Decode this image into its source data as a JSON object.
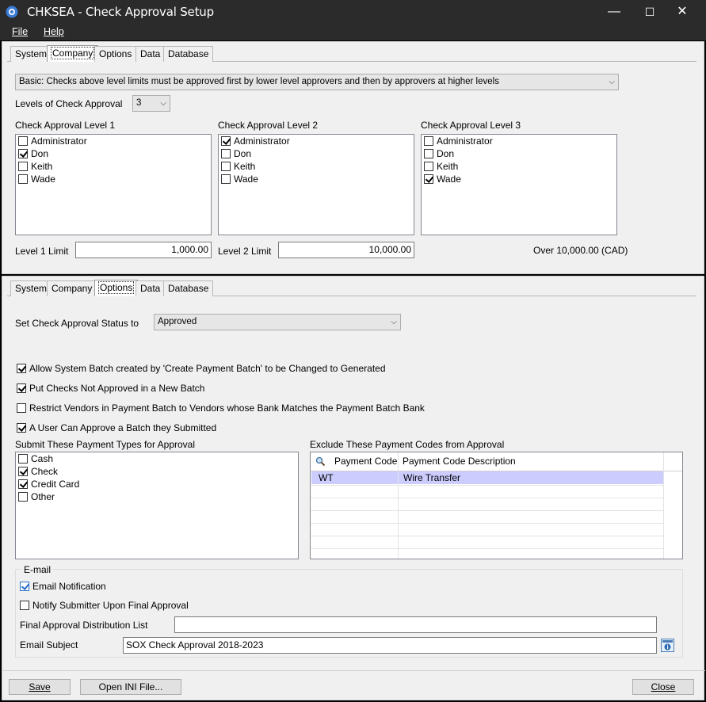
{
  "window": {
    "title": "CHKSEA - Check Approval Setup",
    "minimize": "—",
    "maximize": "☐",
    "close": "✕"
  },
  "menu": {
    "file": "File",
    "help": "Help"
  },
  "tabs": [
    "System",
    "Company",
    "Options",
    "Data",
    "Database"
  ],
  "company": {
    "approval_mode": "Basic: Checks above level limits must be approved first by lower level approvers and then by approvers at higher levels",
    "levels_label": "Levels of Check Approval",
    "levels_value": "3",
    "level1": {
      "label": "Check Approval Level 1",
      "items": [
        {
          "name": "Administrator",
          "checked": false
        },
        {
          "name": "Don",
          "checked": true
        },
        {
          "name": "Keith",
          "checked": false
        },
        {
          "name": "Wade",
          "checked": false
        }
      ]
    },
    "level2": {
      "label": "Check Approval Level 2",
      "items": [
        {
          "name": "Administrator",
          "checked": true
        },
        {
          "name": "Don",
          "checked": false
        },
        {
          "name": "Keith",
          "checked": false
        },
        {
          "name": "Wade",
          "checked": false
        }
      ]
    },
    "level3": {
      "label": "Check Approval Level 3",
      "items": [
        {
          "name": "Administrator",
          "checked": false
        },
        {
          "name": "Don",
          "checked": false
        },
        {
          "name": "Keith",
          "checked": false
        },
        {
          "name": "Wade",
          "checked": true
        }
      ]
    },
    "limit1_label": "Level 1 Limit",
    "limit1_value": "1,000.00",
    "limit2_label": "Level 2 Limit",
    "limit2_value": "10,000.00",
    "over_text": "Over 10,000.00 (CAD)"
  },
  "options": {
    "status_label": "Set Check Approval Status to",
    "status_value": "Approved",
    "opt1": {
      "label": "Allow System Batch created by 'Create Payment Batch' to be Changed to Generated",
      "checked": true
    },
    "opt2": {
      "label": "Put Checks Not Approved in a New Batch",
      "checked": true
    },
    "opt3": {
      "label": "Restrict Vendors in Payment Batch to Vendors whose Bank Matches the Payment Batch Bank",
      "checked": false
    },
    "opt4": {
      "label": "A User Can Approve a Batch they Submitted",
      "checked": true
    },
    "types_label": "Submit These Payment Types for Approval",
    "types": [
      {
        "name": "Cash",
        "checked": false
      },
      {
        "name": "Check",
        "checked": true
      },
      {
        "name": "Credit Card",
        "checked": true
      },
      {
        "name": "Other",
        "checked": false
      }
    ],
    "exclude_label": "Exclude These Payment Codes from Approval",
    "grid_headers": [
      "Payment Code",
      "Payment Code Description"
    ],
    "grid_rows": [
      {
        "code": "WT",
        "desc": "Wire Transfer"
      }
    ],
    "email": {
      "group_label": "E-mail",
      "notification": {
        "label": "Email Notification",
        "checked": true
      },
      "notify_submitter": {
        "label": "Notify Submitter Upon Final Approval",
        "checked": false
      },
      "dist_label": "Final Approval Distribution List",
      "dist_value": "",
      "subject_label": "Email Subject",
      "subject_value": "SOX Check Approval 2018-2023"
    }
  },
  "buttons": {
    "save": "Save",
    "open_ini": "Open INI File...",
    "close": "Close"
  },
  "colors": {
    "title_bg": "#2b2b2b",
    "selected_row": "#ccccff",
    "panel": "#f0f0f0"
  }
}
